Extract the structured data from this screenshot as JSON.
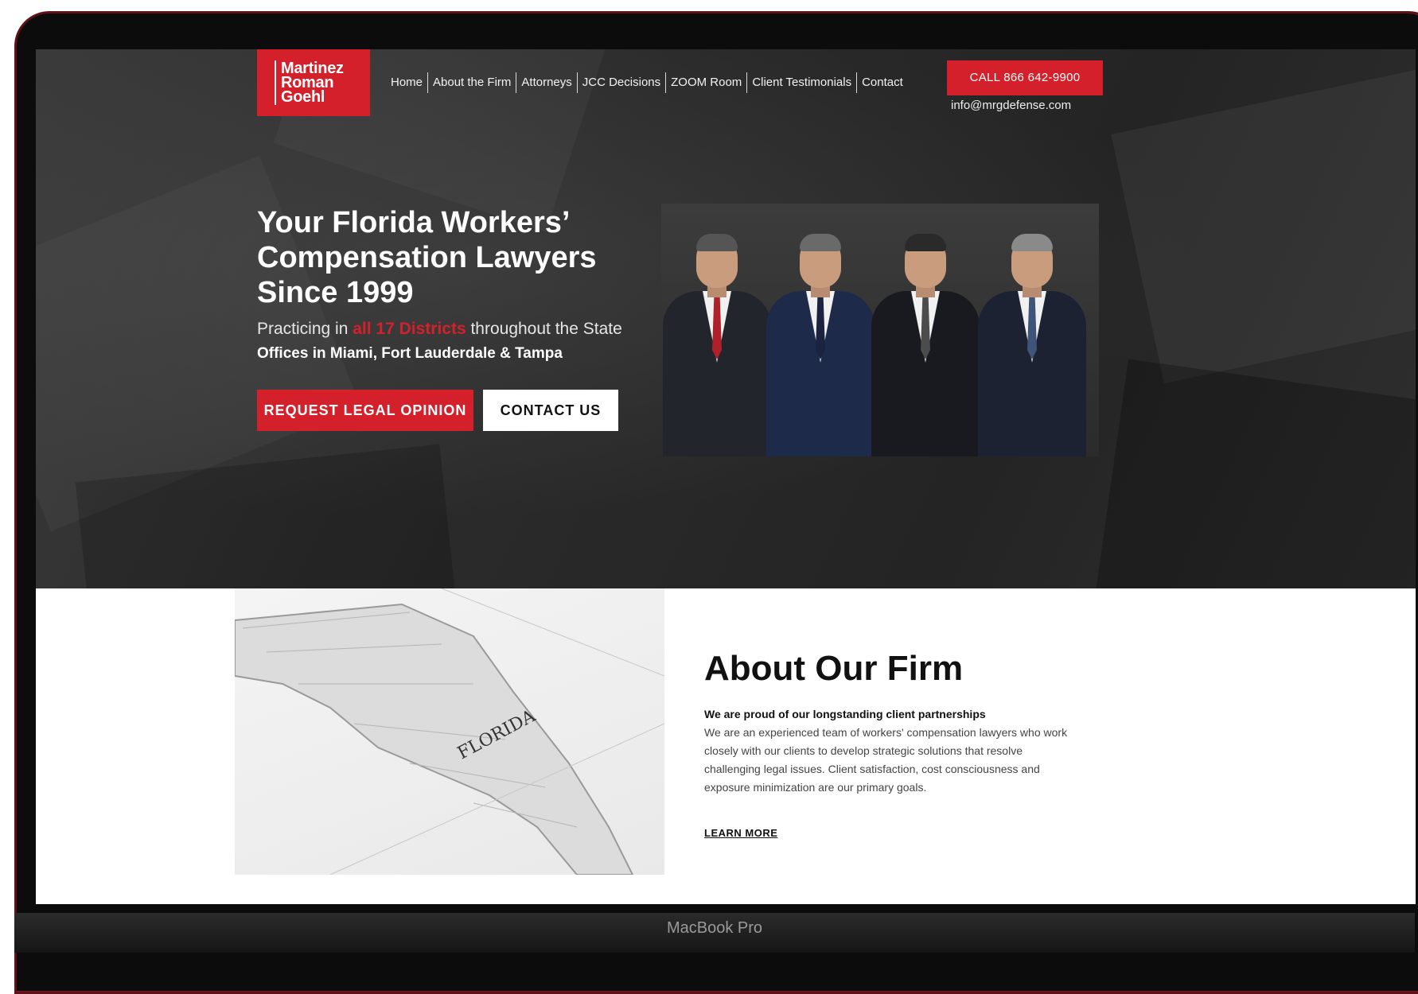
{
  "site": {
    "logo": {
      "line1": "Martinez",
      "line2": "Roman",
      "line3": "Goehl"
    },
    "nav": [
      "Home",
      "About the Firm",
      "Attorneys",
      "JCC Decisions",
      "ZOOM Room",
      "Client Testimonials",
      "Contact"
    ],
    "call_button": "CALL 866 642-9900",
    "email": "info@mrgdefense.com"
  },
  "hero": {
    "headline_line1": "Your Florida Workers’",
    "headline_line2": "Compensation Lawyers",
    "headline_line3": "Since 1999",
    "practicing_prefix": "Practicing in ",
    "practicing_highlight": "all 17 Districts",
    "practicing_suffix": " throughout the State",
    "offices": "Offices in Miami, Fort Lauderdale & Tampa",
    "primary_button": "REQUEST LEGAL OPINION",
    "secondary_button": "CONTACT US"
  },
  "about": {
    "title": "About Our Firm",
    "subtitle": "We are proud of our longstanding client partnerships",
    "body": "We are an experienced team of workers' compensation lawyers who work closely with our clients to develop strategic solutions that resolve challenging legal issues. Client satisfaction, cost consciousness and exposure minimization are our primary goals.",
    "link": "LEARN MORE",
    "map_label": "FLORIDA"
  },
  "device": {
    "label": "MacBook Pro"
  },
  "colors": {
    "brand_red": "#d4202a",
    "hero_bg": "#2a2a2a"
  }
}
